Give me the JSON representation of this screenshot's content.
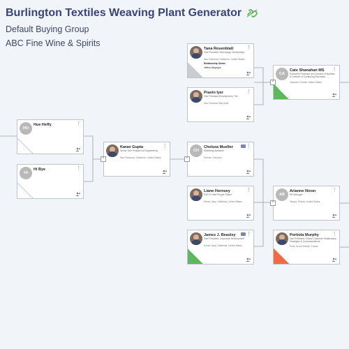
{
  "header": {
    "title": "Burlington Textiles Weaving Plant Generator",
    "subtitle_1": "Default Buying Group",
    "subtitle_2": "ABC Fine Wine & Spirits"
  },
  "colors": {
    "title": "#3a4477",
    "wedge_green": "#5cb85c",
    "wedge_orange": "#ef6a45",
    "wedge_gray": "#c9ccd1"
  },
  "cards": {
    "hue_heffy": {
      "name": "Hue Heffy",
      "initials": "HU"
    },
    "hi_bye": {
      "name": "Hi Bye",
      "initials": "HI"
    },
    "karan_gupta": {
      "name": "Karan Gupta",
      "role": "Senior Vice President of Engineering",
      "location": "San Francisco, California, United States"
    },
    "tana_rosenblatt": {
      "name": "Tana Rosenblatt",
      "role": "Vice President Technology Partnerships",
      "location": "San Francisco, California, United States",
      "extra1": "Relationship Owner",
      "extra2": "Jeffrey Mcgregor"
    },
    "pravin_iyer": {
      "name": "Pravin Iyer",
      "role": "Vice President Development, Tier",
      "location": "San Francisco Bay Area"
    },
    "cate_shanahan": {
      "name": "Cate Shanahan MS",
      "initials": "CA",
      "role": "Executive Professor and Director of Nutrition & Lecturer of Continuing Education",
      "location": "Lineland, Florida, United States"
    },
    "chelsea_mueller": {
      "name": "Chelsea Mueller",
      "initials": "CH",
      "role": "Marketing Assistant",
      "location": "Denver, Colorado"
    },
    "liane_hornsey": {
      "name": "Liane Hornsey",
      "role": "EVP & Chief People Officer",
      "location": "Santa Clara, California, United States"
    },
    "arianne_nixon": {
      "name": "Arianne Nixon",
      "initials": "AR",
      "role": "HR Manager",
      "location": "Tampa, Florida, United States"
    },
    "james_beasley": {
      "name": "James J. Beasley",
      "role": "Vice President, Corporate Development",
      "location": "Santa Clara, California, United States"
    },
    "portiola_murphy": {
      "name": "Portiola Murphy",
      "role": "Vice President, Global Customer Relationship Strategies & Communications",
      "location": "Paris, Île-de-France, France"
    }
  },
  "controls": {
    "kebab": "⋮",
    "collapse": "^"
  },
  "icons": {
    "link": "link-icon",
    "team": "team-icon",
    "chat": "chat-icon"
  }
}
